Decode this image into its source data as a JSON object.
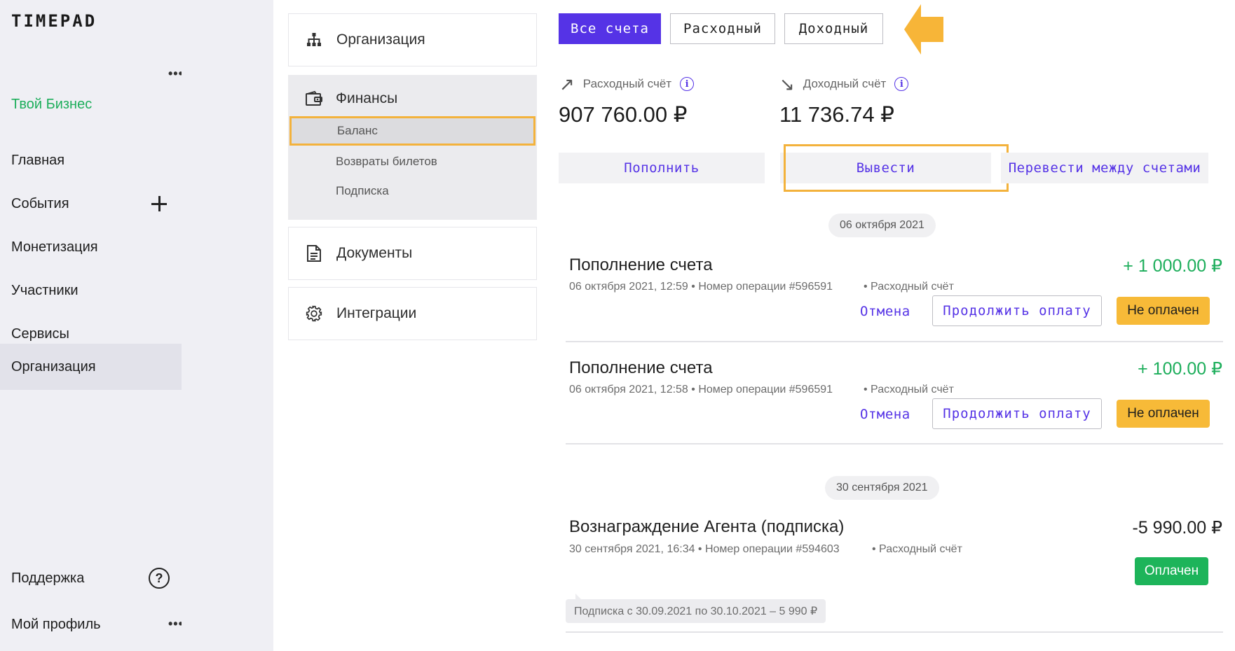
{
  "sidebar": {
    "logo": "TIMEPAD",
    "business": "Твой Бизнес",
    "items": [
      {
        "label": "Главная"
      },
      {
        "label": "События"
      },
      {
        "label": "Монетизация"
      },
      {
        "label": "Участники"
      },
      {
        "label": "Сервисы"
      },
      {
        "label": "Организация"
      }
    ],
    "support": "Поддержка",
    "profile": "Мой профиль",
    "more_glyph": "•••",
    "help_glyph": "?"
  },
  "settings_nav": {
    "organization": "Организация",
    "finance": "Финансы",
    "finance_sub": [
      {
        "label": "Баланс"
      },
      {
        "label": "Возвраты билетов"
      },
      {
        "label": "Подписка"
      }
    ],
    "documents": "Документы",
    "integrations": "Интеграции"
  },
  "filters": {
    "all": "Все счета",
    "expense": "Расходный",
    "income": "Доходный"
  },
  "accounts": {
    "expense_label": "Расходный счёт",
    "expense_amount": "907 760.00 ₽",
    "income_label": "Доходный счёт",
    "income_amount": "11 736.74 ₽",
    "info_glyph": "i"
  },
  "actions": {
    "topup": "Пополнить",
    "withdraw": "Вывести",
    "transfer": "Перевести между счетами"
  },
  "groups": [
    {
      "date": "06 октября 2021",
      "transactions": [
        {
          "title": "Пополнение счета",
          "meta": "06 октября 2021, 12:59 • Номер операции #596591",
          "account": "• Расходный счёт",
          "amount": "+ 1 000.00 ₽",
          "cancel": "Отмена",
          "continue": "Продолжить оплату",
          "status": "Не оплачен"
        },
        {
          "title": "Пополнение счета",
          "meta": "06 октября 2021, 12:58 • Номер операции #596591",
          "account": "• Расходный счёт",
          "amount": "+ 100.00 ₽",
          "cancel": "Отмена",
          "continue": "Продолжить оплату",
          "status": "Не оплачен"
        }
      ]
    },
    {
      "date": "30 сентября 2021",
      "transactions": [
        {
          "title": "Вознаграждение Агента (подписка)",
          "meta": "30 сентября 2021, 16:34 • Номер операции #594603",
          "account": "• Расходный счёт",
          "amount": "-5 990.00 ₽",
          "status": "Оплачен",
          "note": "Подписка с 30.09.2021 по 30.10.2021 – 5 990 ₽"
        }
      ]
    }
  ],
  "colors": {
    "accent": "#5533e6",
    "positive": "#1dae5b",
    "unpaid": "#f7ba38",
    "paid": "#1db45a",
    "highlight": "#f3b23c"
  },
  "icons": {
    "organization": "org-structure-icon",
    "finance": "wallet-icon",
    "documents": "document-icon",
    "integrations": "gear-icon",
    "expense": "arrow-up-right-icon",
    "income": "arrow-down-right-icon"
  }
}
